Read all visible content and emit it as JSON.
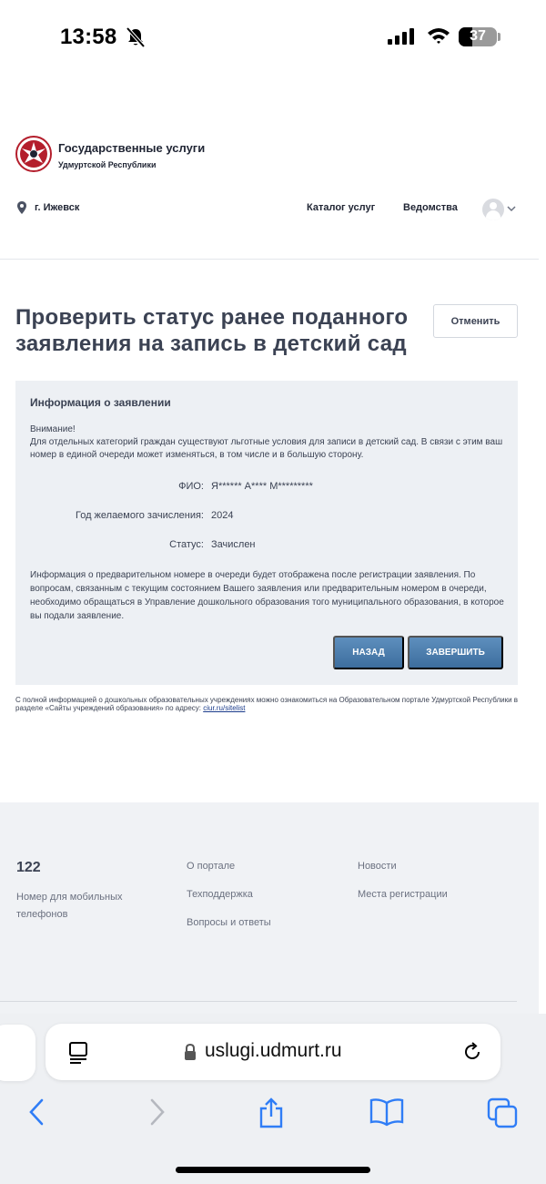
{
  "status_bar": {
    "time": "13:58",
    "battery": "37"
  },
  "header": {
    "brand_title": "Государственные услуги",
    "brand_subtitle": "Удмуртской Республики",
    "city": "г. Ижевск",
    "nav": {
      "catalog": "Каталог услуг",
      "departments": "Ведомства"
    }
  },
  "page": {
    "title": "Проверить статус ранее поданного заявления на запись в детский сад",
    "cancel_label": "Отменить"
  },
  "panel": {
    "title": "Информация о заявлении",
    "warning_heading": "Внимание!",
    "warning_text": "Для отдельных категорий граждан существуют льготные условия для записи в детский сад. В связи с этим ваш номер в единой очереди может изменяться, в том числе и в большую сторону.",
    "rows": [
      {
        "label": "ФИО:",
        "value": "Я****** А**** М*********"
      },
      {
        "label": "Год желаемого зачисления:",
        "value": "2024"
      },
      {
        "label": "Статус:",
        "value": "Зачислен"
      }
    ],
    "note": "Информация о предварительном номере в очереди будет отображена после регистрации заявления. По вопросам, связанным с текущим состоянием Вашего заявления или предварительным номером в очереди, необходимо обращаться в Управление дошкольного образования того муниципального образования, в которое вы подали заявление.",
    "back_label": "НАЗАД",
    "finish_label": "ЗАВЕРШИТЬ"
  },
  "footnote": {
    "text": "С полной информацией о дошкольных образовательных учреждениях можно ознакомиться на Образовательном портале Удмуртской Республики в разделе «Сайты учреждений образования» по адресу: ",
    "link": "ciur.ru/sitelist"
  },
  "footer": {
    "phone": "122",
    "phone_caption": "Номер для мобильных телефонов",
    "links_col1": [
      "О портале",
      "Техподдержка",
      "Вопросы и ответы"
    ],
    "links_col2": [
      "Новости",
      "Места регистрации"
    ]
  },
  "browser": {
    "url": "uslugi.udmurt.ru"
  },
  "colors": {
    "accent_button": "#4a7caa",
    "panel_bg": "#edf0f4",
    "footer_bg": "#f0f2f5",
    "title": "#3b4253"
  }
}
